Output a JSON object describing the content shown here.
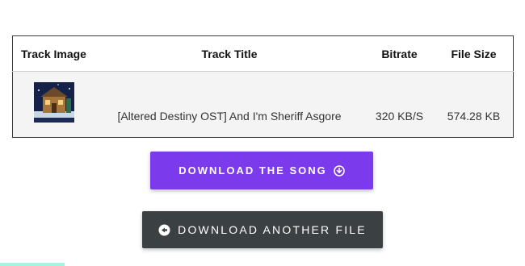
{
  "table": {
    "headers": {
      "image": "Track Image",
      "title": "Track Title",
      "bitrate": "Bitrate",
      "size": "File Size"
    },
    "rows": [
      {
        "title": "[Altered Destiny OST] And I'm Sheriff Asgore",
        "bitrate": "320 KB/S",
        "size": "574.28 KB",
        "image_icon": "album-art-thumbnail"
      }
    ]
  },
  "buttons": {
    "download_song": "DOWNLOAD THE SONG",
    "download_song_icon": "download-circle-icon",
    "download_another": "DOWNLOAD ANOTHER FILE",
    "download_another_icon": "arrow-left-circle-icon"
  },
  "colors": {
    "primary": "#7c3aed",
    "secondary": "#3b4043",
    "accent_strip": "#a7f3e0"
  }
}
